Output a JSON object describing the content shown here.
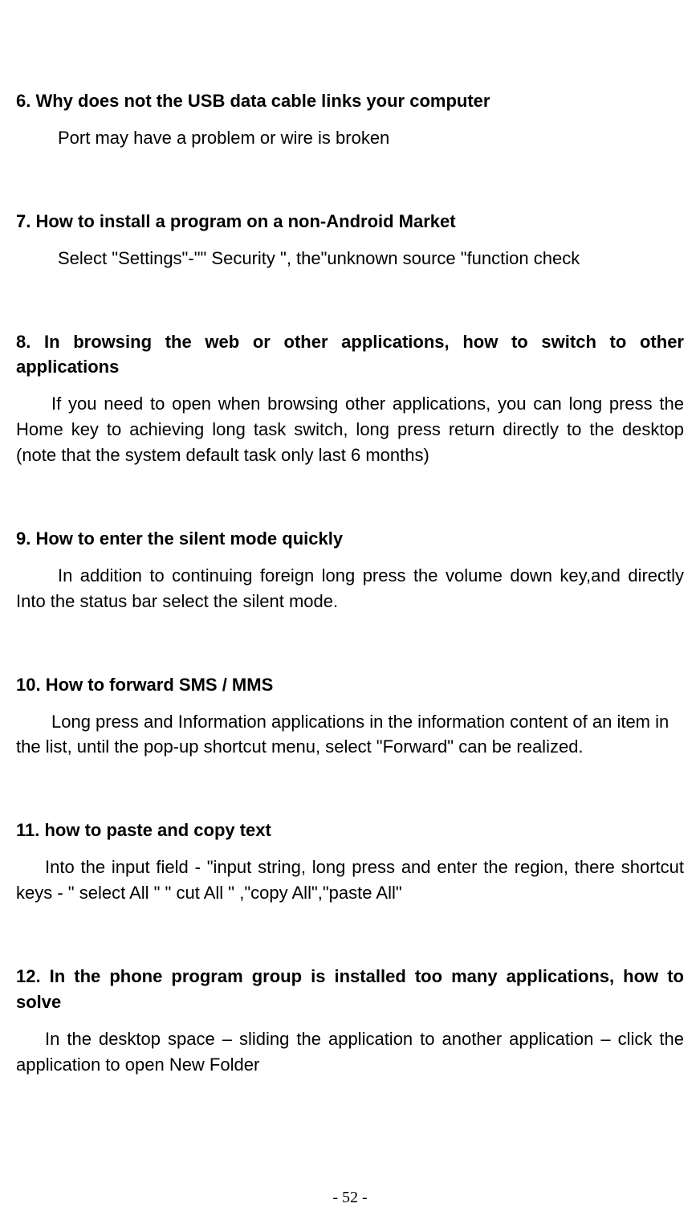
{
  "sections": [
    {
      "heading": "6. Why does not the USB data cable links your computer",
      "body": "Port may have a problem or wire is broken",
      "indent": "indent-lg"
    },
    {
      "heading": "7. How to install a program on a non-Android Market",
      "body": "Select \"Settings\"-\"\" Security \", the\"unknown source \"function check",
      "indent": "indent-lg"
    },
    {
      "heading": "8. In browsing the web or other applications, how to switch to other applications",
      "body": "If you need to open when browsing other applications, you can long press the Home key to achieving long task switch, long press return directly to the desktop (note that the system default task only last 6 months)",
      "indent": "indent-md"
    },
    {
      "heading": "9. How to enter the silent mode quickly",
      "body": "In addition to continuing foreign long press the volume down key,and directly Into the status bar select the silent mode.",
      "indent": "indent-lg"
    },
    {
      "heading": "10. How to forward SMS / MMS",
      "body": "Long press and Information applications in the information content of an item in the list, until the pop-up shortcut menu, select \"Forward\" can be realized.",
      "indent": "indent-md",
      "nojustify": true
    },
    {
      "heading": "11. how to paste and copy text",
      "body": "Into the input field - \"input string, long press and enter the region, there shortcut keys - \" select All \" \" cut All \" ,\"copy All\",\"paste All\"",
      "indent": "indent-sm"
    },
    {
      "heading": "12. In the phone program group is installed too many applications, how to solve",
      "body": "In the desktop space – sliding the application to another application – click the application to open New Folder",
      "indent": "indent-sm"
    }
  ],
  "pageNumber": "- 52 -"
}
